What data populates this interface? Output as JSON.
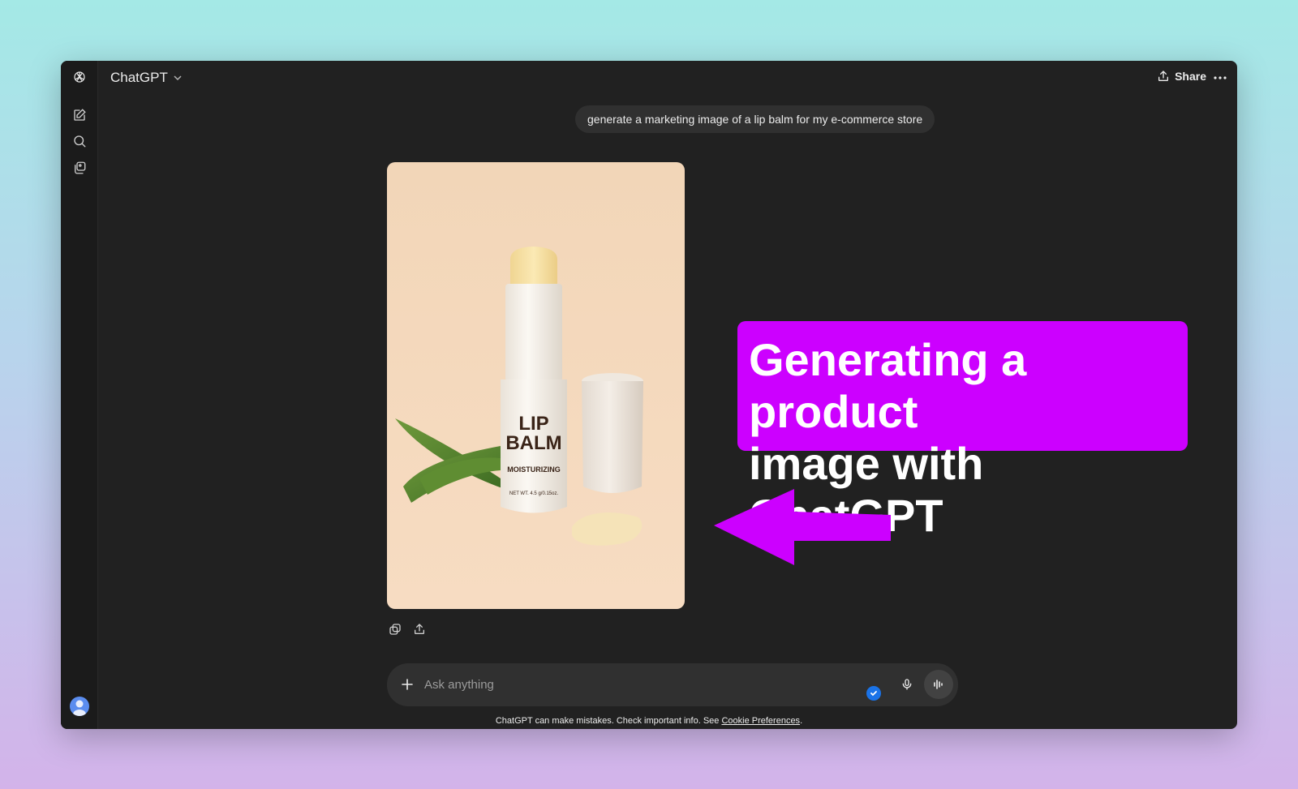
{
  "app": {
    "model_label": "ChatGPT",
    "share_label": "Share"
  },
  "sidebar": {
    "items": [
      {
        "icon": "new-chat-icon"
      },
      {
        "icon": "search-icon"
      },
      {
        "icon": "library-icon"
      }
    ],
    "avatar_icon": "user-avatar"
  },
  "conversation": {
    "user_message": "generate a marketing image of a lip balm for my e-commerce store",
    "generated_image": {
      "product_title_line1": "LIP",
      "product_title_line2": "BALM",
      "product_subtitle": "MOISTURIZING",
      "product_net_weight": "NET WT. 4.5 g/0.15oz."
    },
    "message_actions": [
      "copy-icon",
      "share-icon"
    ]
  },
  "composer": {
    "placeholder": "Ask anything",
    "value": ""
  },
  "footer": {
    "disclaimer_prefix": "ChatGPT can make mistakes. Check important info. See ",
    "cookie_link": "Cookie Preferences",
    "disclaimer_suffix": "."
  },
  "annotation": {
    "callout_line1": "Generating a product",
    "callout_line2": "image with ChatGPT",
    "color": "#cc00ff"
  },
  "colors": {
    "window_bg": "#212121",
    "bubble_bg": "#303030",
    "text": "#ececec",
    "accent_blue": "#1a73e8"
  }
}
